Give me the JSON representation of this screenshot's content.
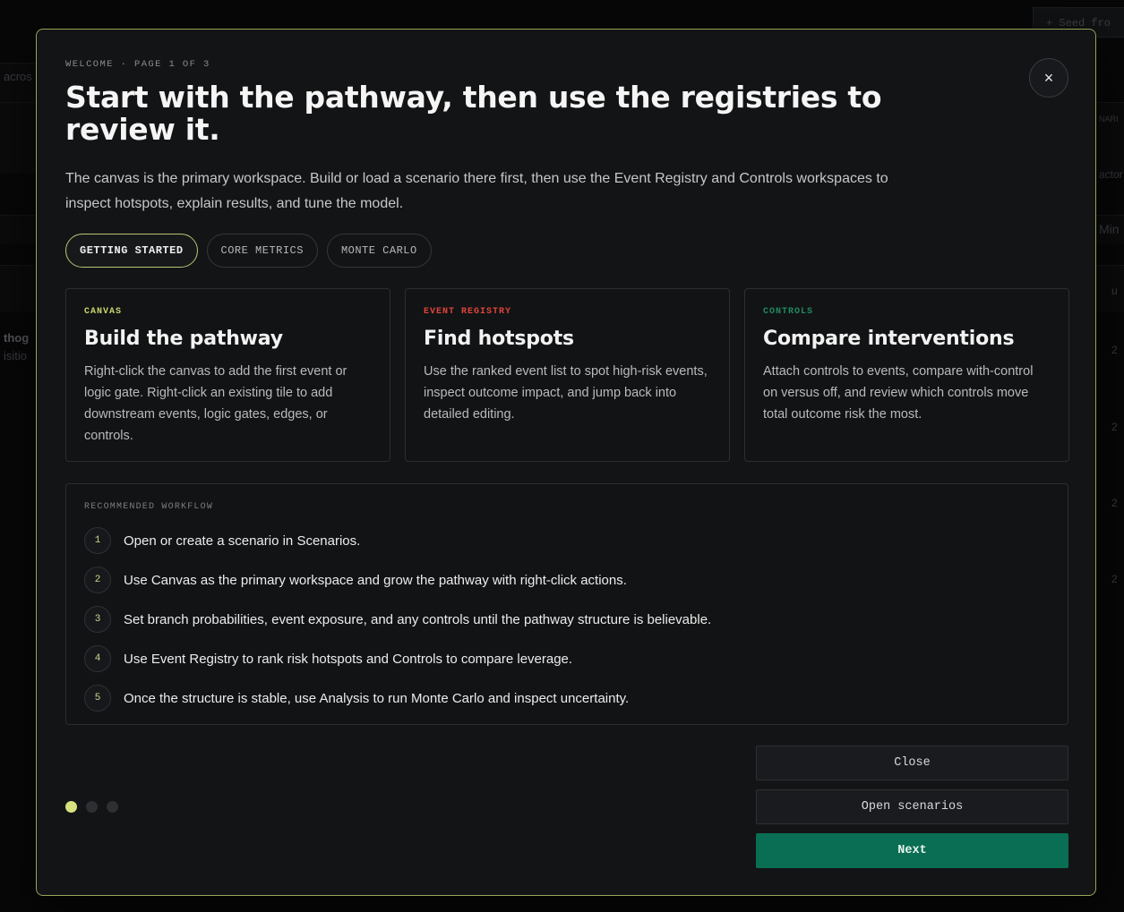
{
  "background": {
    "top_right_button": "+ Seed fro",
    "left_texts": [
      "acros",
      "thog",
      "isitio"
    ],
    "right_texts": [
      "NARI",
      "actor",
      "Min",
      "u",
      "2",
      "2",
      "2",
      "2"
    ]
  },
  "modal": {
    "eyebrow": "WELCOME · PAGE 1 OF 3",
    "title": "Start with the pathway, then use the registries to review it.",
    "subtitle": "The canvas is the primary workspace. Build or load a scenario there first, then use the Event Registry and Controls workspaces to inspect hotspots, explain results, and tune the model.",
    "close_icon": "×",
    "tabs": [
      {
        "label": "GETTING STARTED",
        "active": true
      },
      {
        "label": "CORE METRICS",
        "active": false
      },
      {
        "label": "MONTE CARLO",
        "active": false
      }
    ],
    "cards": [
      {
        "tag": "CANVAS",
        "tag_color": "#c9d46a",
        "title": "Build the pathway",
        "body": "Right-click the canvas to add the first event or logic gate. Right-click an existing tile to add downstream events, logic gates, edges, or controls."
      },
      {
        "tag": "EVENT REGISTRY",
        "tag_color": "#e0453a",
        "title": "Find hotspots",
        "body": "Use the ranked event list to spot high-risk events, inspect outcome impact, and jump back into detailed editing."
      },
      {
        "tag": "CONTROLS",
        "tag_color": "#1f8a5f",
        "title": "Compare interventions",
        "body": "Attach controls to events, compare with-control on versus off, and review which controls move total outcome risk the most."
      }
    ],
    "workflow": {
      "title": "RECOMMENDED WORKFLOW",
      "steps": [
        {
          "num": "1",
          "text": "Open or create a scenario in Scenarios."
        },
        {
          "num": "2",
          "text": "Use Canvas as the primary workspace and grow the pathway with right-click actions."
        },
        {
          "num": "3",
          "text": "Set branch probabilities, event exposure, and any controls until the pathway structure is believable."
        },
        {
          "num": "4",
          "text": "Use Event Registry to rank risk hotspots and Controls to compare leverage."
        },
        {
          "num": "5",
          "text": "Once the structure is stable, use Analysis to run Monte Carlo and inspect uncertainty."
        }
      ]
    },
    "pagination": {
      "current": 1,
      "total": 3
    },
    "buttons": {
      "close": "Close",
      "open_scenarios": "Open scenarios",
      "next": "Next"
    },
    "colors": {
      "accent": "#d6e17f",
      "primary_button": "#0a6e54",
      "border": "#9aa35a"
    }
  }
}
